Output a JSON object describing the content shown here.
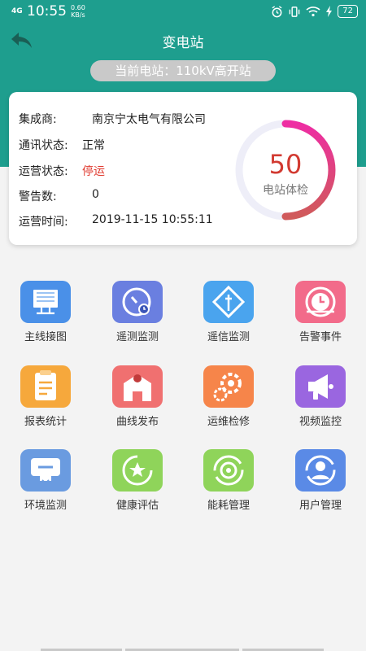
{
  "status_bar": {
    "network": "4G",
    "time": "10:55",
    "speed_value": "0.60",
    "speed_unit": "KB/s",
    "battery": "72",
    "icons": [
      "alarm-icon",
      "vibrate-icon",
      "wifi-icon",
      "charging-icon",
      "battery-icon"
    ]
  },
  "header": {
    "title": "变电站",
    "current_station": "当前电站：110kV高开站",
    "color": "#1e9e8e"
  },
  "info": {
    "integrator_label": "集成商:",
    "integrator_value": "南京宁太电气有限公司",
    "comm_label": "通讯状态:",
    "comm_value": "正常",
    "operation_label": "运营状态:",
    "operation_value": "停运",
    "alarm_label": "警告数:",
    "alarm_value": "0",
    "time_label": "运营时间:",
    "time_value": "2019-11-15 10:55:11"
  },
  "gauge": {
    "score": "50",
    "score_fraction": 0.5,
    "label": "电站体检",
    "colors": [
      "#ee2da3",
      "#d05a5a"
    ]
  },
  "menu": [
    {
      "label": "主线接图",
      "icon": "wiring-diagram-icon",
      "color": "#4a90e8"
    },
    {
      "label": "遥测监测",
      "icon": "telemetry-gauge-icon",
      "color": "#6a7fe0"
    },
    {
      "label": "遥信监测",
      "icon": "signal-transfer-icon",
      "color": "#4aa4ee"
    },
    {
      "label": "告警事件",
      "icon": "alarm-clock-icon",
      "color": "#f26b8a"
    },
    {
      "label": "报表统计",
      "icon": "report-icon",
      "color": "#f6a83c"
    },
    {
      "label": "曲线发布",
      "icon": "location-map-icon",
      "color": "#f07070"
    },
    {
      "label": "运维检修",
      "icon": "maintenance-gear-icon",
      "color": "#f6854a"
    },
    {
      "label": "视频监控",
      "icon": "megaphone-icon",
      "color": "#9a66e0"
    },
    {
      "label": "环境监测",
      "icon": "environment-monitor-icon",
      "color": "#6a9be0"
    },
    {
      "label": "健康评估",
      "icon": "health-star-icon",
      "color": "#8fd45a"
    },
    {
      "label": "能耗管理",
      "icon": "energy-icon",
      "color": "#8fd45a"
    },
    {
      "label": "用户管理",
      "icon": "user-icon",
      "color": "#5a8ae6"
    }
  ]
}
